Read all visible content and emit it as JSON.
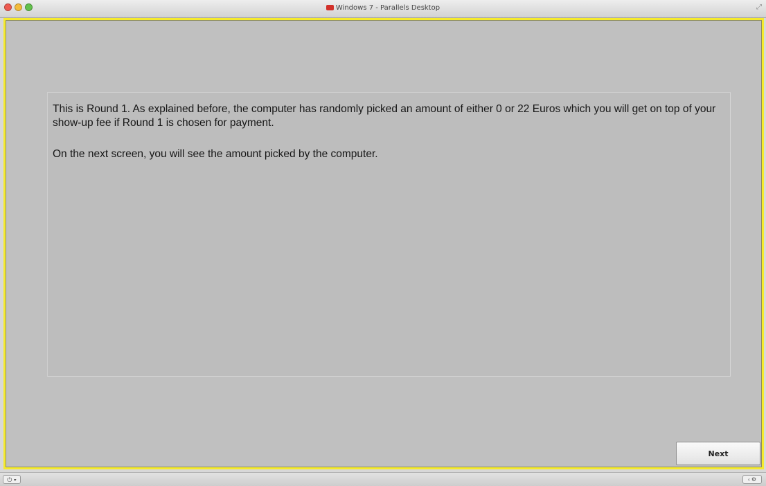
{
  "window": {
    "title": "Windows 7 - Parallels Desktop",
    "controls": {
      "close_icon": "close-icon",
      "minimize_icon": "minimize-icon",
      "zoom_icon": "zoom-icon"
    },
    "fullscreen_glyph": "⤢"
  },
  "frame": {
    "border_color": "#f5ea2e",
    "background": "#c0c0c0"
  },
  "content": {
    "paragraph_1": "This is Round 1. As explained before, the computer has randomly picked an amount of either 0 or 22 Euros which you will get on top of your show-up fee if Round 1 is chosen for payment.",
    "paragraph_2": "On the next screen, you will see the amount picked by the computer."
  },
  "buttons": {
    "next_label": "Next"
  },
  "statusbar": {
    "power_glyph": "⏻ ▾",
    "nav_glyph": "‹ ⚙"
  }
}
